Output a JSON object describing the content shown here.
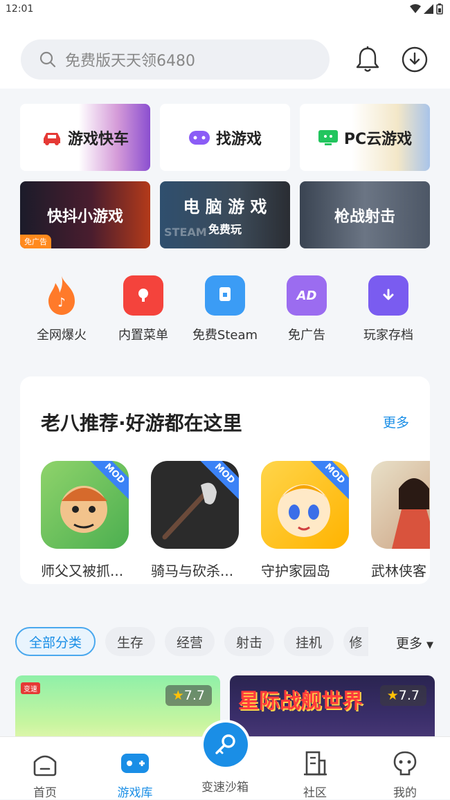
{
  "status": {
    "time": "12:01"
  },
  "search": {
    "placeholder_text": "免费版天天领6480"
  },
  "top_cards": [
    {
      "label": "游戏快车"
    },
    {
      "label": "找游戏"
    },
    {
      "label": "PC云游戏"
    },
    {
      "label": "快抖小游戏",
      "badge": "免广告"
    },
    {
      "label": "电 脑 游 戏",
      "sublabel": "免费玩",
      "watermark": "STEAM"
    },
    {
      "label": "枪战射击"
    }
  ],
  "quick_actions": [
    {
      "label": "全网爆火",
      "icon": "fire-icon",
      "color": "#ff7a2a"
    },
    {
      "label": "内置菜单",
      "icon": "menu-icon",
      "color": "#f4433c"
    },
    {
      "label": "免费Steam",
      "icon": "monitor-icon",
      "color": "#3b9cf5"
    },
    {
      "label": "免广告",
      "icon": "ad-gift-icon",
      "color": "#9b6cf0"
    },
    {
      "label": "玩家存档",
      "icon": "save-download-icon",
      "color": "#7a5cf0"
    }
  ],
  "recommend": {
    "title": "老八推荐·好游都在这里",
    "more": "更多",
    "games": [
      {
        "name": "师父又被抓...",
        "badge": "MOD"
      },
      {
        "name": "骑马与砍杀...",
        "badge": "MOD"
      },
      {
        "name": "守护家园岛",
        "badge": "MOD"
      },
      {
        "name": "武林侠客",
        "badge": ""
      }
    ]
  },
  "categories": {
    "items": [
      "全部分类",
      "生存",
      "经营",
      "射击",
      "挂机",
      "修"
    ],
    "more": "更多"
  },
  "banners": [
    {
      "rating": "7.7",
      "tag": "变速"
    },
    {
      "rating": "7.7",
      "title": "星际战舰世界"
    }
  ],
  "tabbar": {
    "tabs": [
      {
        "label": "首页"
      },
      {
        "label": "游戏库"
      },
      {
        "label": "变速沙箱"
      },
      {
        "label": "社区"
      },
      {
        "label": "我的"
      }
    ]
  },
  "colors": {
    "accent": "#1a8ee6",
    "background": "#f4f6f9"
  }
}
